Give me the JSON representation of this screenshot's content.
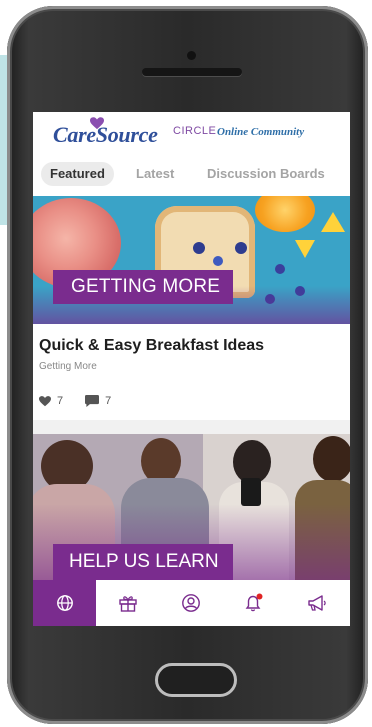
{
  "header": {
    "brand": "CareSource",
    "circle": "CIRCLE",
    "community": "Online Community"
  },
  "tabs": [
    {
      "label": "Featured",
      "active": true
    },
    {
      "label": "Latest",
      "active": false
    },
    {
      "label": "Discussion Boards",
      "active": false
    }
  ],
  "posts": [
    {
      "banner": "GETTING MORE",
      "title": "Quick & Easy Breakfast Ideas",
      "category": "Getting More",
      "likes": "7",
      "comments": "7"
    },
    {
      "banner": "HELP US LEARN"
    }
  ],
  "nav": [
    {
      "icon": "globe-icon",
      "active": true
    },
    {
      "icon": "gift-icon",
      "active": false
    },
    {
      "icon": "profile-icon",
      "active": false
    },
    {
      "icon": "bell-icon",
      "active": false
    },
    {
      "icon": "megaphone-icon",
      "active": false
    }
  ],
  "colors": {
    "brand_purple": "#7a2c8e",
    "brand_blue": "#2f4f9a",
    "notification_red": "#e02424"
  }
}
